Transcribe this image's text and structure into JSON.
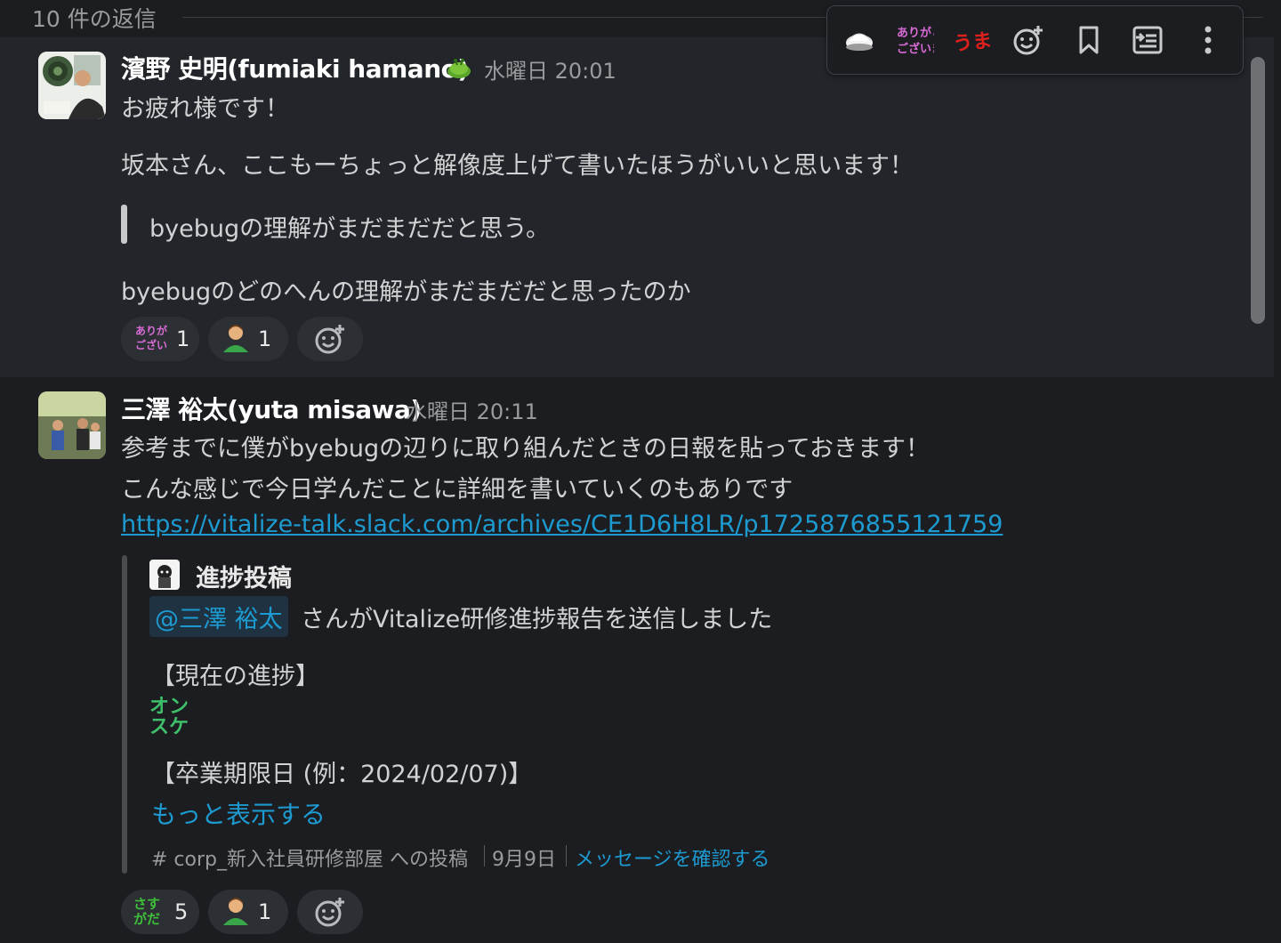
{
  "thread": {
    "replies_count": "10 件の返信"
  },
  "toolbar": {
    "thanks_icon_text": "ありがとうございます",
    "umai_icon_text": "うまい!"
  },
  "message1": {
    "sender": "濱野 史明(fumiaki hamano)",
    "time": "水曜日 20:01",
    "lines": [
      "お疲れ様です！",
      "坂本さん、ここもーちょっと解像度上げて書いたほうがいいと思います！",
      "byebugの理解がまだまだだと思う。",
      "byebugのどのへんの理解がまだまだだと思ったのか"
    ],
    "reactions": [
      {
        "icon": "thanks-emoji",
        "count": "1"
      },
      {
        "icon": "person-emoji",
        "count": "1"
      }
    ]
  },
  "message2": {
    "sender": "三澤 裕太(yuta misawa)",
    "time": "水曜日 20:11",
    "lines": [
      "参考までに僕がbyebugの辺りに取り組んだときの日報を貼っておきます！",
      "こんな感じで今日学んだことに詳細を書いていくのもありです"
    ],
    "link": "https://vitalize-talk.slack.com/archives/CE1D6H8LR/p1725876855121759",
    "attachment": {
      "title": "進捗投稿",
      "mention": "@三澤 裕太",
      "mention_suffix": "さんがVitalize研修進捗報告を送信しました",
      "progress_label": "【現在の進捗】",
      "progress_emoji_text": "オンスケ",
      "deadline_label": "【卒業期限日 (例：2024/02/07)】",
      "show_more": "もっと表示する",
      "channel": "# corp_新入社員研修部屋 への投稿",
      "date": "9月9日",
      "view_message": "メッセージを確認する"
    },
    "reactions": [
      {
        "icon": "sasuga-emoji",
        "count": "5"
      },
      {
        "icon": "person-emoji",
        "count": "1"
      }
    ]
  }
}
